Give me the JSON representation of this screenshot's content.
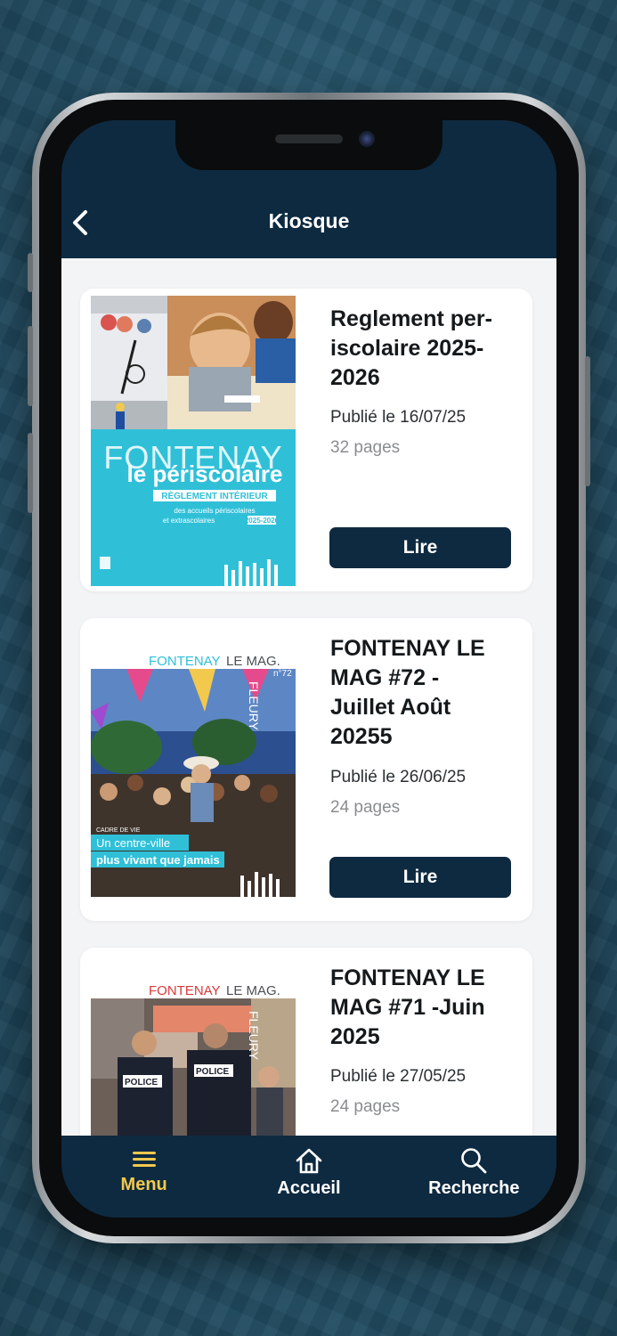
{
  "header": {
    "title": "Kiosque",
    "back_icon": "chevron-left-icon"
  },
  "items": [
    {
      "title": "Reglement per-iscolaire 2025-2026",
      "date": "Publié le 16/07/25",
      "pages": "32 pages",
      "button": "Lire",
      "cover": {
        "brand": "FONTENAY",
        "subtitle": "le périscolaire",
        "banner": "RÈGLEMENT INTÉRIEUR",
        "line1": "des accueils périscolaires",
        "line2": "et extrascolaires",
        "years": "2025-2026",
        "color": "#2fc0d8"
      }
    },
    {
      "title": "FONTENAY LE MAG #72 - Juillet Août 20255",
      "date": "Publié le 26/06/25",
      "pages": "24 pages",
      "button": "Lire",
      "cover": {
        "masthead_a": "FONTENAY",
        "masthead_b": "LE MAG.",
        "side": "FLEURY",
        "issue": "n°72",
        "kicker": "CADRE DE VIE",
        "headline1": "Un centre-ville",
        "headline2": "plus vivant que jamais"
      }
    },
    {
      "title": "FONTENAY LE MAG #71 -Juin 2025",
      "date": "Publié le 27/05/25",
      "pages": "24 pages",
      "cover": {
        "masthead_a": "FONTENAY",
        "masthead_b": "LE MAG.",
        "side": "FLEURY",
        "badge": "POLICE"
      }
    }
  ],
  "nav": [
    {
      "label": "Menu",
      "icon": "menu-icon",
      "active": true
    },
    {
      "label": "Accueil",
      "icon": "home-icon",
      "active": false
    },
    {
      "label": "Recherche",
      "icon": "search-icon",
      "active": false
    }
  ],
  "colors": {
    "primary": "#0e2a41",
    "accent": "#f2c94c",
    "background": "#f3f4f6"
  }
}
